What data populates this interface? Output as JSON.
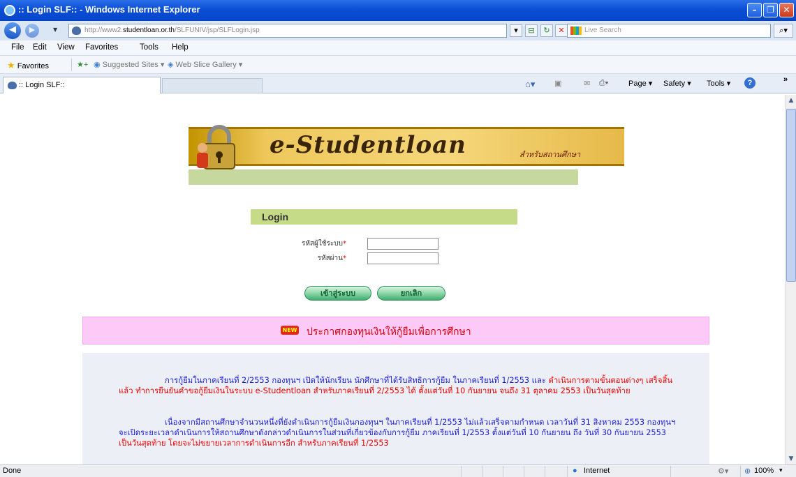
{
  "window": {
    "title": ":: Login SLF:: - Windows Internet Explorer",
    "min_glyph": "–",
    "max_glyph": "❐",
    "close_glyph": "✕"
  },
  "address": {
    "prefix": "http://www2.",
    "domain": "studentloan.or.th",
    "path": "/SLFUNIV/jsp/SLFLogin.jsp",
    "search_placeholder": "Live Search"
  },
  "menu": [
    "File",
    "Edit",
    "View",
    "Favorites",
    "Tools",
    "Help"
  ],
  "favorites_bar": {
    "favorites_label": "Favorites",
    "suggested_label": "Suggested Sites ▾",
    "webslice_label": "Web Slice Gallery ▾"
  },
  "tab": {
    "title": ":: Login SLF::"
  },
  "command_bar": {
    "page": "Page ▾",
    "safety": "Safety ▾",
    "tools": "Tools ▾",
    "help": "?"
  },
  "banner": {
    "brand": "e-Studentloan",
    "subtitle": "สำหรับสถานศึกษา"
  },
  "login": {
    "header": "Login",
    "username_label": "รหัสผู้ใช้ระบบ",
    "password_label": "รหัสผ่าน",
    "required_mark": "*",
    "submit_label": "เข้าสู่ระบบ",
    "cancel_label": "ยกเลิก"
  },
  "announcement": {
    "badge": "NEW",
    "title": "ประกาศกองทุนเงินให้กู้ยืมเพื่อการศึกษา"
  },
  "news": {
    "p1_blue": "การกู้ยืมในภาคเรียนที่ 2/2553 กองทุนฯ เปิดให้นักเรียน นักศึกษาที่ได้รับสิทธิการกู้ยืม ในภาคเรียนที่ 1/2553 และ",
    "p1_red": "ดำเนินการตามขั้นตอนต่างๆ เสร็จสิ้นแล้ว ทำการยืนยันคำขอกู้ยืมเงินในระบบ e-Studentloan สำหรับภาคเรียนที่ 2/2553 ได้ ตั้งแต่วันที่ 10 กันยายน จนถึง 31 ตุลาคม 2553 เป็นวันสุดท้าย",
    "p2_blue": "เนื่องจากมีสถานศึกษาจำนวนหนึ่งที่ยังดำเนินการกู้ยืมเงินกองทุนฯ ในภาคเรียนที่ 1/2553 ไม่แล้วเสร็จตามกำหนด เวลาวันที่ 31 สิงหาคม 2553 กองทุนฯจะเปิดระยะเวลาดำเนินการให้สถานศึกษาดังกล่าวดำเนินการในส่วนที่เกี่ยวข้องกับการกู้ยืม ภาคเรียนที่ 1/2553 ตั้งแต่วันที่ 10 กันยายน ถึง วันที่ 30 กันยายน 2553",
    "p2_red": "เป็นวันสุดท้าย โดยจะไม่ขยายเวลาการดำเนินการอีก สำหรับภาคเรียนที่ 1/2553"
  },
  "status": {
    "left": "Done",
    "zone": "Internet",
    "zoom": "100%"
  }
}
